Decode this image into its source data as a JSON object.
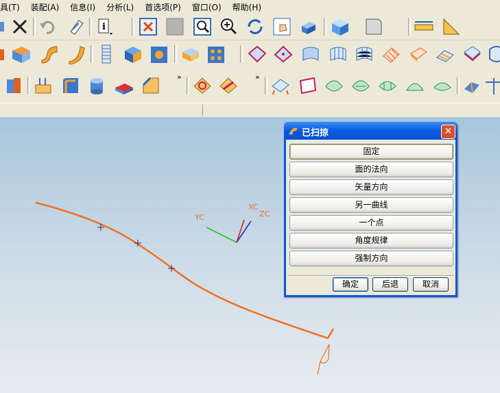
{
  "menu": [
    "具(T)",
    "装配(A)",
    "信息(I)",
    "分析(L)",
    "首选项(P)",
    "窗口(O)",
    "帮助(H)"
  ],
  "toolbar_overflow": "»",
  "dialog": {
    "title": "已扫掠",
    "close_glyph": "✕",
    "options": [
      "固定",
      "面的法向",
      "矢量方向",
      "另一曲线",
      "一个点",
      "角度规律",
      "强制方向"
    ],
    "ok_label": "确定",
    "back_label": "后退",
    "cancel_label": "取消"
  },
  "viewport": {
    "axis_labels": {
      "yc": "YC",
      "xc": "XC",
      "zc": "ZC"
    }
  },
  "colors": {
    "curve": "#f0701e",
    "dialog_title": "#0a56e0",
    "close": "#d9512c"
  }
}
